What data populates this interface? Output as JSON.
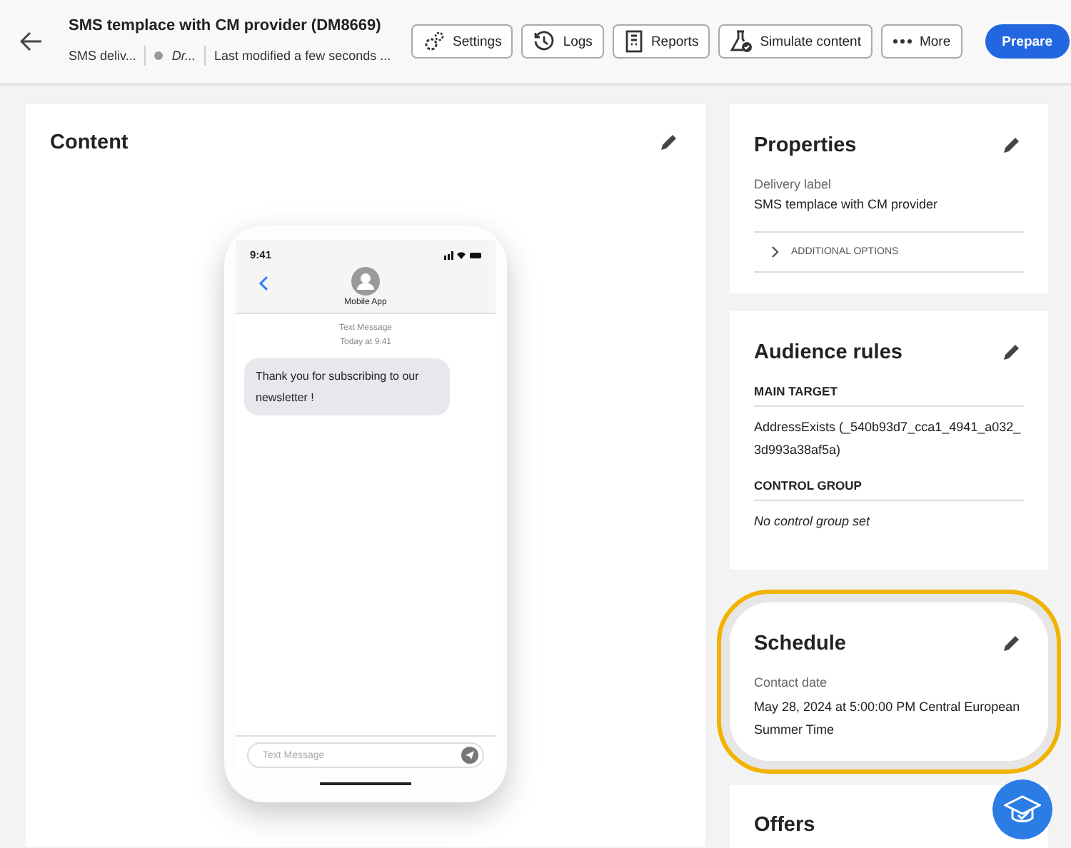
{
  "header": {
    "title": "SMS templace with CM provider (DM8669)",
    "channel": "SMS deliv...",
    "status": "Dr...",
    "modified": "Last modified a few seconds ...",
    "buttons": [
      {
        "kind": "settings",
        "label": "Settings"
      },
      {
        "kind": "logs",
        "label": "Logs"
      },
      {
        "kind": "reports",
        "label": "Reports"
      },
      {
        "kind": "simulate",
        "label": "Simulate content"
      },
      {
        "kind": "more",
        "label": "More"
      }
    ],
    "primary": "Prepare"
  },
  "content": {
    "title": "Content",
    "phone": {
      "time": "9:41",
      "contact": "Mobile App",
      "thread_label": "Text Message",
      "thread_time": "Today at 9:41",
      "message": "Thank you for subscribing to our newsletter !",
      "input_placeholder": "Text Message"
    }
  },
  "properties": {
    "title": "Properties",
    "field_label": "Delivery label",
    "field_value": "SMS templace with CM provider",
    "expander": {
      "label": "ADDITIONAL OPTIONS",
      "expanded": false
    }
  },
  "audience": {
    "title": "Audience rules",
    "sections": [
      {
        "heading": "MAIN TARGET",
        "text": "AddressExists (_540b93d7_cca1_4941_a032_3d993a38af5a)",
        "kind": "value"
      },
      {
        "heading": "CONTROL GROUP",
        "text": "No control group set",
        "kind": "empty"
      }
    ]
  },
  "schedule": {
    "title": "Schedule",
    "highlighted": true,
    "field_label": "Contact date",
    "field_value": "May 28, 2024 at 5:00:00 PM Central European Summer Time"
  },
  "offers": {
    "title": "Offers"
  }
}
